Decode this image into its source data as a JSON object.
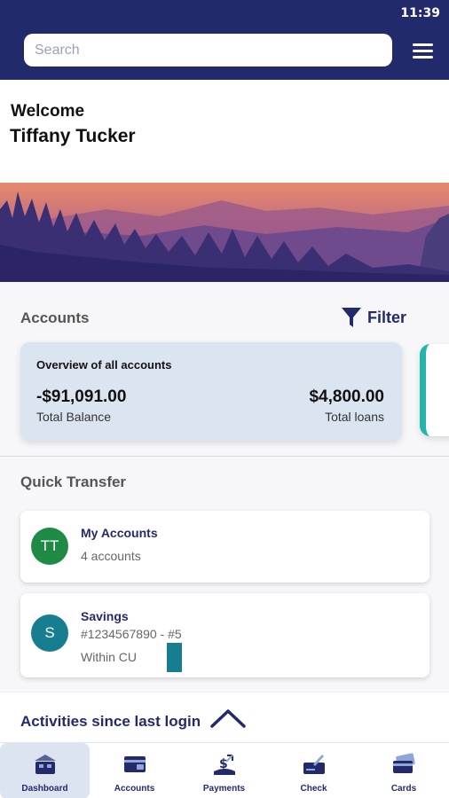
{
  "status_bar": {
    "time": "11:39"
  },
  "header": {
    "search_placeholder": "Search"
  },
  "welcome": {
    "greeting": "Welcome",
    "name": "Tiffany Tucker"
  },
  "accounts": {
    "title": "Accounts",
    "filter_label": "Filter",
    "overview": {
      "title": "Overview of all accounts",
      "total_balance": "-$91,091.00",
      "total_balance_label": "Total Balance",
      "total_loans": "$4,800.00",
      "total_loans_label": "Total loans"
    }
  },
  "quick_transfer": {
    "title": "Quick Transfer",
    "items": [
      {
        "initials": "TT",
        "name": "My Accounts",
        "line1": "4 accounts",
        "avatar_color": "#1e8a46"
      },
      {
        "initials": "S",
        "name": "Savings",
        "line1": "#1234567890 - #5",
        "line2": "Within CU",
        "avatar_color": "#177d91"
      }
    ]
  },
  "activities": {
    "label": "Activities since last login"
  },
  "bottom_nav": {
    "active": "Dashboard",
    "items": [
      {
        "label": "Dashboard",
        "icon": "dashboard-icon"
      },
      {
        "label": "Accounts",
        "icon": "accounts-icon"
      },
      {
        "label": "Payments",
        "icon": "payments-icon"
      },
      {
        "label": "Check",
        "icon": "check-icon"
      },
      {
        "label": "Cards",
        "icon": "cards-icon"
      }
    ]
  },
  "colors": {
    "primary": "#232a6b",
    "card_bg": "#dbe5f1",
    "accent_teal": "#23b5a9"
  }
}
